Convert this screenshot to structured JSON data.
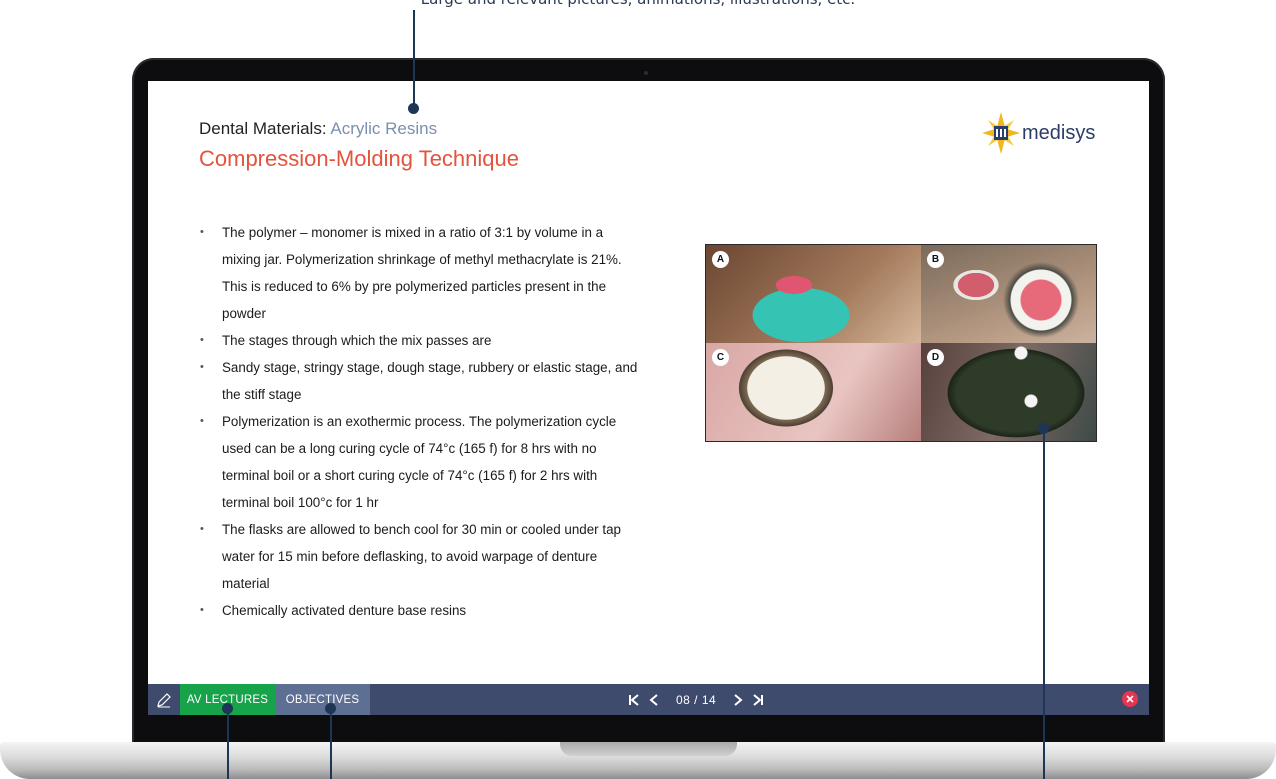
{
  "top_caption": "Large and relevant pictures, animations, illustrations, etc.",
  "slide": {
    "title_prefix": "Dental Materials:",
    "title_topic": "Acrylic Resins",
    "subtitle": "Compression-Molding Technique",
    "logo_text": "medisys",
    "bullets": [
      "The polymer – monomer is mixed in a ratio of 3:1 by volume in a mixing jar. Polymerization shrinkage of methyl methacrylate is 21%. This is reduced to 6% by pre polymerized particles present in the powder",
      "The stages through which the mix passes are",
      "Sandy stage, stringy stage, dough stage, rubbery or elastic stage, and the stiff stage",
      "Polymerization is an exothermic process. The polymerization cycle used can be a long curing cycle of 74°c (165 f) for 8 hrs with no terminal boil or a short curing cycle of 74°c (165 f) for 2 hrs with terminal boil 100°c for 1 hr",
      "The flasks are allowed to bench cool for 30 min or cooled under tap water for 15 min before deflasking, to avoid warpage of denture material",
      "Chemically activated denture base resins"
    ],
    "photo_labels": [
      "A",
      "B",
      "C",
      "D"
    ]
  },
  "toolbar": {
    "av_lectures": "AV LECTURES",
    "objectives": "OBJECTIVES",
    "page_indicator": "08 / 14",
    "icons": [
      "pen-icon",
      "first-page-icon",
      "prev-page-icon",
      "next-page-icon",
      "last-page-icon",
      "close-icon"
    ]
  },
  "colors": {
    "subtitle": "#e2543d",
    "topic": "#7b8fb0",
    "toolbar_bg": "#3e4b6d",
    "av_button": "#16a34a",
    "objectives_button": "#5d6f93",
    "close": "#e8354f"
  }
}
